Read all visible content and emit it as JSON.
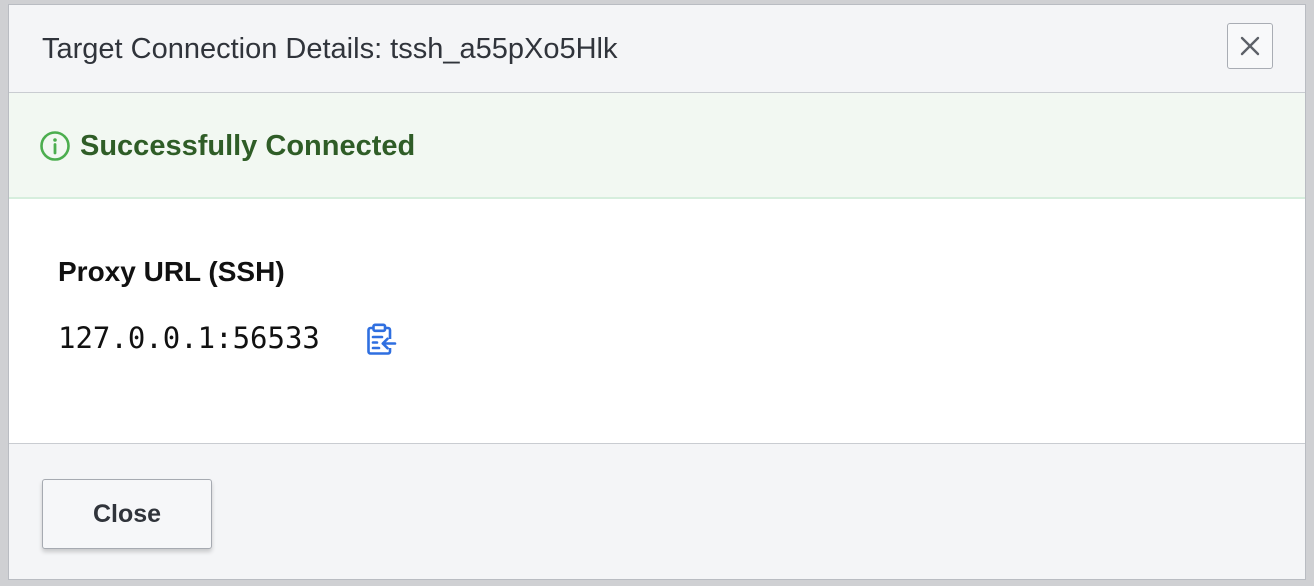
{
  "dialog": {
    "title": "Target Connection Details: tssh_a55pXo5Hlk",
    "close_icon": "close-icon"
  },
  "status": {
    "text": "Successfully Connected",
    "icon": "info-circle-icon",
    "color": "#2f5d27",
    "icon_color": "#4cae4f"
  },
  "proxy": {
    "label": "Proxy URL (SSH)",
    "value": "127.0.0.1:56533",
    "copy_icon": "copy-to-clipboard-icon",
    "copy_icon_color": "#2f6fe0"
  },
  "footer": {
    "close_label": "Close"
  }
}
